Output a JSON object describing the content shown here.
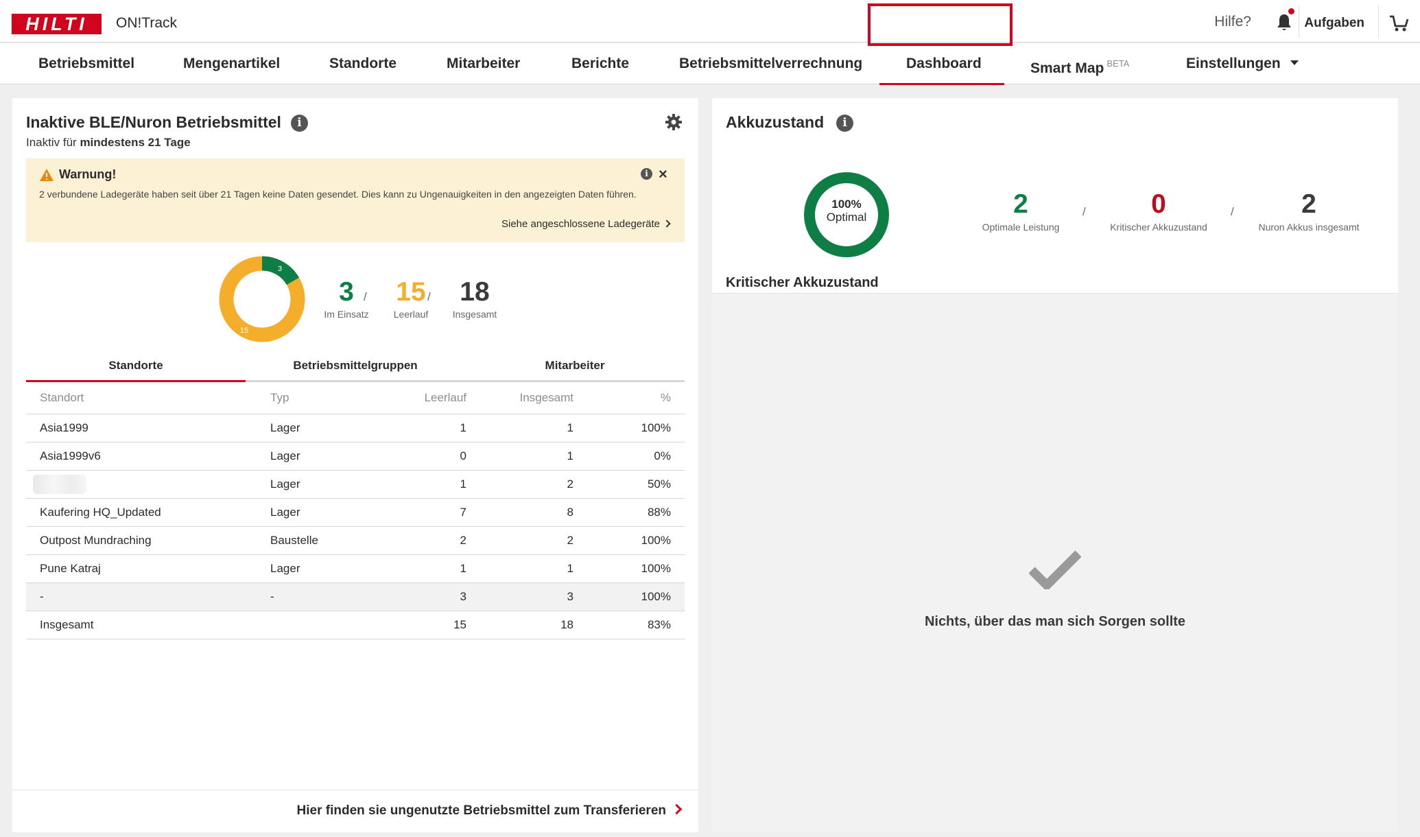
{
  "header": {
    "logo_text": "HILTI",
    "app_name": "ON!Track",
    "help": "Hilfe?",
    "tasks": "Aufgaben",
    "brand_color": "#d2051e",
    "icons": [
      "bell-icon",
      "cart-icon"
    ]
  },
  "nav": {
    "items": [
      {
        "label": "Betriebsmittel"
      },
      {
        "label": "Mengenartikel"
      },
      {
        "label": "Standorte"
      },
      {
        "label": "Mitarbeiter"
      },
      {
        "label": "Berichte"
      },
      {
        "label": "Betriebsmittelverrechnung"
      },
      {
        "label": "Dashboard",
        "active": true
      },
      {
        "label": "Smart Map",
        "badge": "BETA"
      },
      {
        "label": "Einstellungen"
      }
    ]
  },
  "inactive": {
    "title": "Inaktive BLE/Nuron Betriebsmittel",
    "subtitle_prefix": "Inaktiv für",
    "subtitle_bold": "mindestens 21 Tage",
    "warning": {
      "title": "Warnung!",
      "text": "2 verbundene Ladegeräte haben seit über 21 Tagen keine Daten gesendet. Dies kann zu Ungenauigkeiten in den angezeigten Daten führen.",
      "link": "Siehe angeschlossene Ladegeräte",
      "background": "#fcf1d4"
    },
    "summary": {
      "in_use": {
        "value": "3",
        "label": "Im Einsatz",
        "color": "#0f7e45"
      },
      "idle": {
        "value": "15",
        "label": "Leerlauf",
        "color": "#f5ae2c"
      },
      "total": {
        "value": "18",
        "label": "Insgesamt",
        "color": "#3a3a3a"
      }
    },
    "tabs": [
      "Standorte",
      "Betriebsmittelgruppen",
      "Mitarbeiter"
    ],
    "table": {
      "columns": [
        "Standort",
        "Typ",
        "Leerlauf",
        "Insgesamt",
        "%"
      ],
      "rows": [
        {
          "standort": "Asia1999",
          "typ": "Lager",
          "leerlauf": "1",
          "insgesamt": "1",
          "pct": "100%"
        },
        {
          "standort": "Asia1999v6",
          "typ": "Lager",
          "leerlauf": "0",
          "insgesamt": "1",
          "pct": "0%"
        },
        {
          "standort": "",
          "typ": "Lager",
          "leerlauf": "1",
          "insgesamt": "2",
          "pct": "50%"
        },
        {
          "standort": "Kaufering HQ_Updated",
          "typ": "Lager",
          "leerlauf": "7",
          "insgesamt": "8",
          "pct": "88%"
        },
        {
          "standort": "Outpost Mundraching",
          "typ": "Baustelle",
          "leerlauf": "2",
          "insgesamt": "2",
          "pct": "100%"
        },
        {
          "standort": "Pune Katraj",
          "typ": "Lager",
          "leerlauf": "1",
          "insgesamt": "1",
          "pct": "100%"
        },
        {
          "standort": "-",
          "typ": "-",
          "leerlauf": "3",
          "insgesamt": "3",
          "pct": "100%"
        },
        {
          "standort": "Insgesamt",
          "typ": "",
          "leerlauf": "15",
          "insgesamt": "18",
          "pct": "83%"
        }
      ]
    },
    "footer_link": "Hier finden sie ungenutzte Betriebsmittel zum Transferieren"
  },
  "chart_data": [
    {
      "type": "pie",
      "categories": [
        "Im Einsatz",
        "Leerlauf"
      ],
      "values": [
        3,
        15
      ],
      "colors": [
        "#0f7e45",
        "#f5ae2c"
      ],
      "data_labels": [
        "3",
        "15"
      ]
    },
    {
      "type": "pie",
      "categories": [
        "Optimal"
      ],
      "values": [
        100
      ],
      "colors": [
        "#0f7e45"
      ],
      "center_label": "100% Optimal"
    }
  ],
  "battery": {
    "title": "Akkuzustand",
    "donut_pct": "100%",
    "donut_label": "Optimal",
    "stats": [
      {
        "value": "2",
        "label": "Optimale Leistung",
        "color": "#0f7e45"
      },
      {
        "value": "0",
        "label": "Kritischer Akkuzustand",
        "color": "#b8101f"
      },
      {
        "value": "2",
        "label": "Nuron Akkus insgesamt",
        "color": "#3a3a3a"
      }
    ],
    "critical_title": "Kritischer Akkuzustand",
    "empty_message": "Nichts, über das man sich Sorgen sollte"
  }
}
